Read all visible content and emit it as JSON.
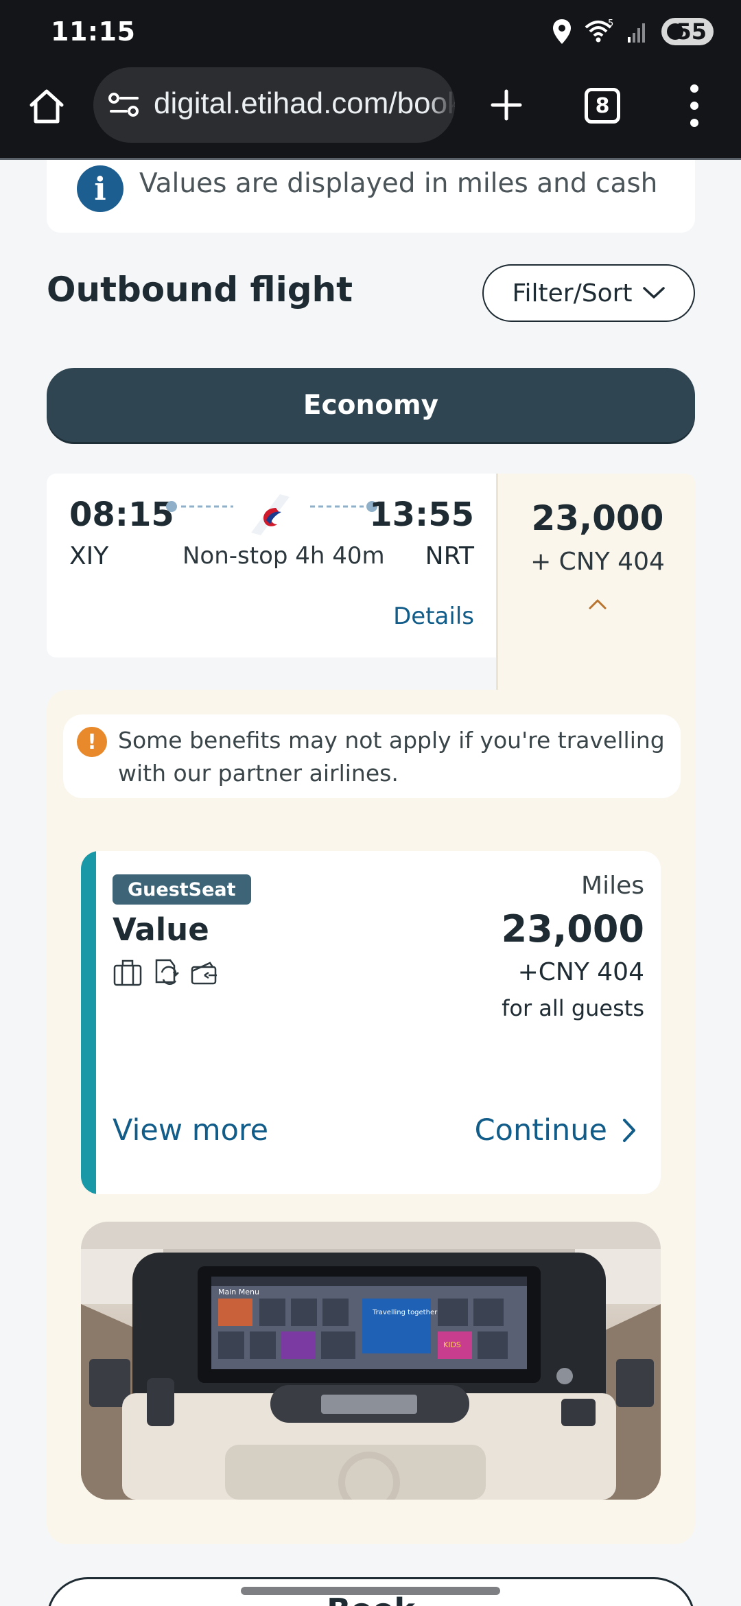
{
  "status_bar": {
    "time": "11:15",
    "battery": "55",
    "wifi_label": "5"
  },
  "browser": {
    "url": "digital.etihad.com/book/flights",
    "tab_count": "8"
  },
  "info_banner": {
    "text": "Values are displayed in miles and cash"
  },
  "outbound": {
    "title": "Outbound flight",
    "filter_label": "Filter/Sort"
  },
  "cabin_tab": {
    "label": "Economy"
  },
  "flight": {
    "depart_time": "08:15",
    "depart_code": "XIY",
    "arrive_time": "13:55",
    "arrive_code": "NRT",
    "duration": "Non-stop 4h 40m",
    "details_label": "Details",
    "miles": "23,000",
    "cash": "+  CNY 404"
  },
  "partner_note": {
    "text": "Some benefits may not apply if you're travelling with our partner airlines."
  },
  "fare": {
    "badge": "GuestSeat",
    "name": "Value",
    "icons": [
      "baggage-icon",
      "change-icon",
      "refund-icon"
    ],
    "miles_label": "Miles",
    "miles": "23,000",
    "cash": "+CNY 404",
    "guests": "for all guests",
    "view_more_label": "View more",
    "continue_label": "Continue"
  },
  "seat_screen": {
    "menu_title": "Main Menu",
    "banner_text": "Travelling together",
    "kids_label": "KIDS"
  },
  "book_button": {
    "label": "Book"
  },
  "colors": {
    "primary_dark": "#2f4552",
    "link_blue": "#115c88",
    "accent_teal": "#1998a8",
    "panel_cream": "#fbf6ec",
    "warning_orange": "#e8892c",
    "info_blue": "#1d5e91"
  }
}
